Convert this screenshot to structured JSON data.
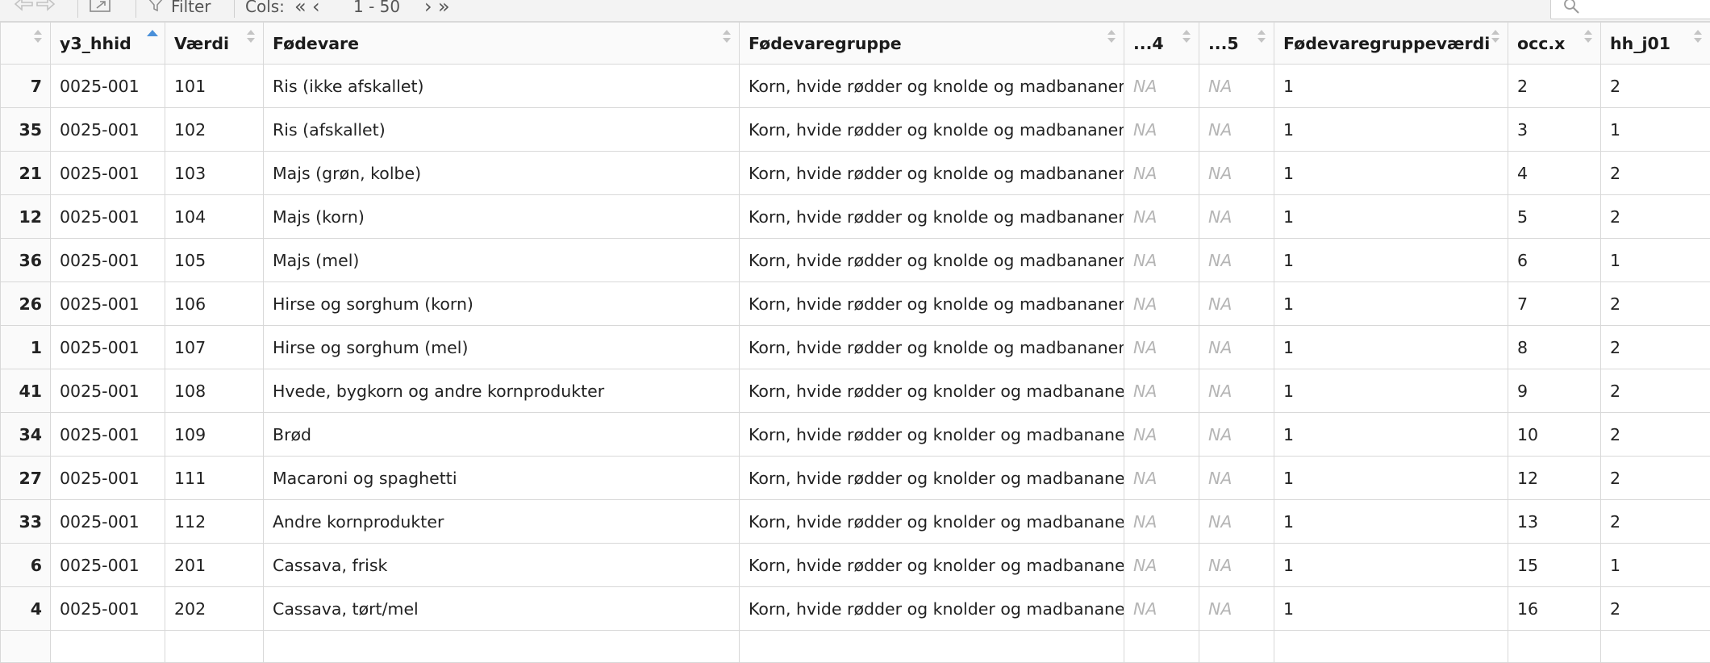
{
  "toolbar": {
    "filter_label": "Filter",
    "cols_label": "Cols:",
    "first_label": "«",
    "prev_label": "‹",
    "range_label": "1 - 50",
    "next_label": "›",
    "last_label": "»"
  },
  "table": {
    "columns": [
      "",
      "y3_hhid",
      "Værdi",
      "Fødevare",
      "Fødevaregruppe",
      "...4",
      "...5",
      "Fødevaregruppeværdi",
      "occ.x",
      "hh_j01"
    ],
    "rows": [
      {
        "row": "7",
        "hhid": "0025-001",
        "vaerdi": "101",
        "fodevare": "Ris (ikke afskallet)",
        "gruppe": "Korn, hvide rødder og knolde og madbananer",
        "c4": "NA",
        "c5": "NA",
        "gv": "1",
        "occ": "2",
        "hh": "2"
      },
      {
        "row": "35",
        "hhid": "0025-001",
        "vaerdi": "102",
        "fodevare": "Ris (afskallet)",
        "gruppe": "Korn, hvide rødder og knolde og madbananer",
        "c4": "NA",
        "c5": "NA",
        "gv": "1",
        "occ": "3",
        "hh": "1"
      },
      {
        "row": "21",
        "hhid": "0025-001",
        "vaerdi": "103",
        "fodevare": "Majs (grøn, kolbe)",
        "gruppe": "Korn, hvide rødder og knolde og madbananer",
        "c4": "NA",
        "c5": "NA",
        "gv": "1",
        "occ": "4",
        "hh": "2"
      },
      {
        "row": "12",
        "hhid": "0025-001",
        "vaerdi": "104",
        "fodevare": "Majs (korn)",
        "gruppe": "Korn, hvide rødder og knolde og madbananer",
        "c4": "NA",
        "c5": "NA",
        "gv": "1",
        "occ": "5",
        "hh": "2"
      },
      {
        "row": "36",
        "hhid": "0025-001",
        "vaerdi": "105",
        "fodevare": "Majs (mel)",
        "gruppe": "Korn, hvide rødder og knolde og madbananer",
        "c4": "NA",
        "c5": "NA",
        "gv": "1",
        "occ": "6",
        "hh": "1"
      },
      {
        "row": "26",
        "hhid": "0025-001",
        "vaerdi": "106",
        "fodevare": "Hirse og sorghum (korn)",
        "gruppe": "Korn, hvide rødder og knolde og madbananer",
        "c4": "NA",
        "c5": "NA",
        "gv": "1",
        "occ": "7",
        "hh": "2"
      },
      {
        "row": "1",
        "hhid": "0025-001",
        "vaerdi": "107",
        "fodevare": "Hirse og sorghum (mel)",
        "gruppe": "Korn, hvide rødder og knolde og madbananer",
        "c4": "NA",
        "c5": "NA",
        "gv": "1",
        "occ": "8",
        "hh": "2"
      },
      {
        "row": "41",
        "hhid": "0025-001",
        "vaerdi": "108",
        "fodevare": "Hvede, bygkorn og andre kornprodukter",
        "gruppe": "Korn, hvide rødder og knolder og madbananer",
        "c4": "NA",
        "c5": "NA",
        "gv": "1",
        "occ": "9",
        "hh": "2"
      },
      {
        "row": "34",
        "hhid": "0025-001",
        "vaerdi": "109",
        "fodevare": "Brød",
        "gruppe": "Korn, hvide rødder og knolder og madbananer",
        "c4": "NA",
        "c5": "NA",
        "gv": "1",
        "occ": "10",
        "hh": "2"
      },
      {
        "row": "27",
        "hhid": "0025-001",
        "vaerdi": "111",
        "fodevare": "Macaroni og spaghetti",
        "gruppe": "Korn, hvide rødder og knolder og madbananer",
        "c4": "NA",
        "c5": "NA",
        "gv": "1",
        "occ": "12",
        "hh": "2"
      },
      {
        "row": "33",
        "hhid": "0025-001",
        "vaerdi": "112",
        "fodevare": "Andre kornprodukter",
        "gruppe": "Korn, hvide rødder og knolder og madbananer",
        "c4": "NA",
        "c5": "NA",
        "gv": "1",
        "occ": "13",
        "hh": "2"
      },
      {
        "row": "6",
        "hhid": "0025-001",
        "vaerdi": "201",
        "fodevare": "Cassava, frisk",
        "gruppe": "Korn, hvide rødder og knolder og madbananer",
        "c4": "NA",
        "c5": "NA",
        "gv": "1",
        "occ": "15",
        "hh": "1"
      },
      {
        "row": "4",
        "hhid": "0025-001",
        "vaerdi": "202",
        "fodevare": "Cassava, tørt/mel",
        "gruppe": "Korn, hvide rødder og knolder og madbananer",
        "c4": "NA",
        "c5": "NA",
        "gv": "1",
        "occ": "16",
        "hh": "2"
      }
    ]
  }
}
